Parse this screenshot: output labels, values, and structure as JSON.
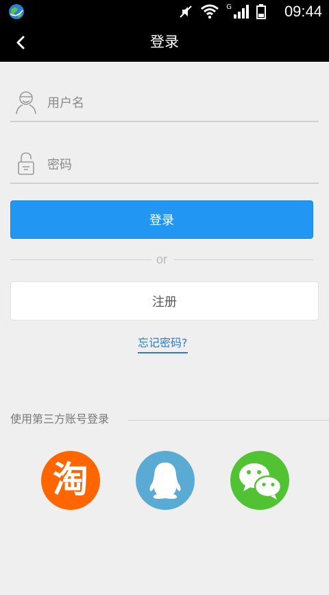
{
  "status_bar": {
    "time": "09:44",
    "network_label": "G"
  },
  "header": {
    "title": "登录"
  },
  "form": {
    "username_placeholder": "用户名",
    "password_placeholder": "密码",
    "login_label": "登录",
    "or_text": "or",
    "register_label": "注册",
    "forgot_label": "忘记密码?"
  },
  "third_party": {
    "label": "使用第三方账号登录",
    "providers": [
      {
        "icon": "taobao-icon",
        "glyph": "淘",
        "color": "#ff6600"
      },
      {
        "icon": "qq-icon",
        "color": "#5aabd3"
      },
      {
        "icon": "wechat-icon",
        "color": "#51c332"
      }
    ]
  },
  "colors": {
    "primary": "#2196f3",
    "link": "#2a7ad2",
    "background": "#efefef"
  }
}
